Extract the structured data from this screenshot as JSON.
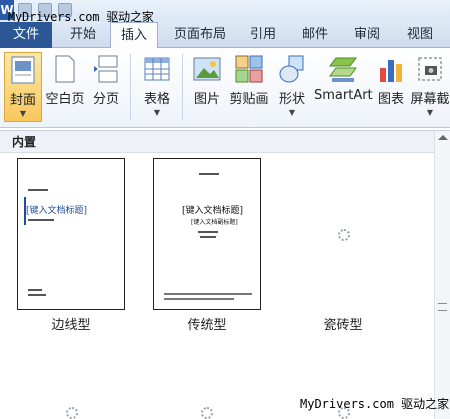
{
  "titlebar": {
    "app_letter": "W",
    "watermark": "MyDrivers.com 驱动之家"
  },
  "tabs": {
    "file": "文件",
    "items": [
      "开始",
      "插入",
      "页面布局",
      "引用",
      "邮件",
      "审阅",
      "视图"
    ],
    "active": "插入"
  },
  "ribbon": {
    "cover": "封面",
    "blank_page": "空白页",
    "page_break": "分页",
    "table": "表格",
    "picture": "图片",
    "clipart": "剪贴画",
    "shapes": "形状",
    "smartart": "SmartArt",
    "chart": "图表",
    "screenshot": "屏幕截"
  },
  "gallery": {
    "header": "内置",
    "items": [
      {
        "caption": "边线型",
        "title": "[键入文档标题]"
      },
      {
        "caption": "传统型",
        "title": "[键入文档标题]",
        "subtitle": "[键入文档副标题]"
      },
      {
        "caption": "瓷砖型"
      }
    ]
  },
  "watermark_bottom": {
    "site": "MyDrivers.com",
    "brand": "驱动之家"
  },
  "colors": {
    "file_tab": "#2b5797",
    "cover_highlight": "#f8c85d",
    "title_blue": "#1f4e9a"
  }
}
